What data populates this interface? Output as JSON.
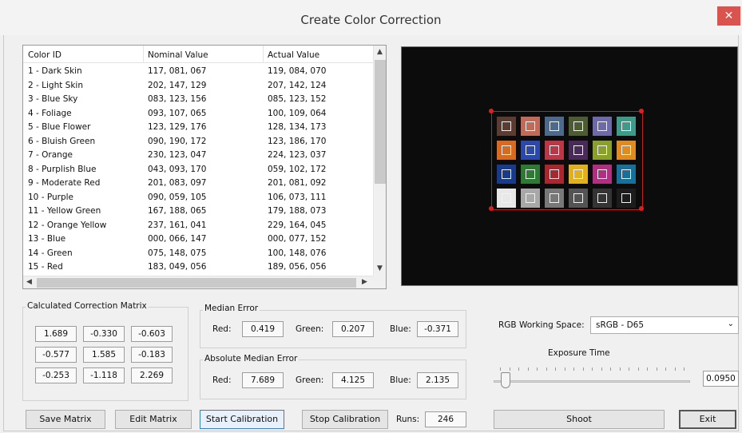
{
  "window": {
    "title": "Create Color Correction",
    "close_glyph": "✕"
  },
  "table": {
    "headers": [
      "Color ID",
      "Nominal Value",
      "Actual Value"
    ],
    "rows": [
      [
        "1 - Dark Skin",
        "117, 081, 067",
        "119, 084, 070"
      ],
      [
        "2 - Light Skin",
        "202, 147, 129",
        "207, 142, 124"
      ],
      [
        "3 - Blue Sky",
        "083, 123, 156",
        "085, 123, 152"
      ],
      [
        "4 - Foliage",
        "093, 107, 065",
        "100, 109, 064"
      ],
      [
        "5 - Blue Flower",
        "123, 129, 176",
        "128, 134, 173"
      ],
      [
        "6 - Bluish Green",
        "090, 190, 172",
        "123, 186, 170"
      ],
      [
        "7 - Orange",
        "230, 123, 047",
        "224, 123, 037"
      ],
      [
        "8 - Purplish Blue",
        "043, 093, 170",
        "059, 102, 172"
      ],
      [
        "9 - Moderate Red",
        "201, 083, 097",
        "201, 081, 092"
      ],
      [
        "10 - Purple",
        "090, 059, 105",
        "106, 073, 111"
      ],
      [
        "11 - Yellow Green",
        "167, 188, 065",
        "179, 188, 073"
      ],
      [
        "12 - Orange Yellow",
        "237, 161, 041",
        "229, 164, 045"
      ],
      [
        "13 - Blue",
        "000, 066, 147",
        "000, 077, 152"
      ],
      [
        "14 - Green",
        "075, 148, 075",
        "100, 148, 076"
      ],
      [
        "15 - Red",
        "183, 049, 056",
        "189, 056, 056"
      ]
    ]
  },
  "preview": {
    "patch_colors": [
      [
        "#5a3c32",
        "#c06a5a",
        "#4d6a8c",
        "#4e5c34",
        "#6e6aa8",
        "#3f9a88"
      ],
      [
        "#d66a20",
        "#2c48a8",
        "#b83848",
        "#4a2a58",
        "#8aa02c",
        "#e08a22"
      ],
      [
        "#1a3a8a",
        "#2e7a34",
        "#a82830",
        "#e0b020",
        "#b03080",
        "#1a6e9a"
      ],
      [
        "#e8e8e8",
        "#a8a8a8",
        "#787878",
        "#545454",
        "#343434",
        "#1c1c1c"
      ]
    ]
  },
  "matrix": {
    "label": "Calculated Correction Matrix",
    "values": [
      [
        "1.689",
        "-0.330",
        "-0.603"
      ],
      [
        "-0.577",
        "1.585",
        "-0.183"
      ],
      [
        "-0.253",
        "-1.118",
        "2.269"
      ]
    ]
  },
  "median_error": {
    "label": "Median Error",
    "red_label": "Red:",
    "red": "0.419",
    "green_label": "Green:",
    "green": "0.207",
    "blue_label": "Blue:",
    "blue": "-0.371"
  },
  "abs_median_error": {
    "label": "Absolute Median Error",
    "red_label": "Red:",
    "red": "7.689",
    "green_label": "Green:",
    "green": "4.125",
    "blue_label": "Blue:",
    "blue": "2.135"
  },
  "rgb_space": {
    "label": "RGB Working Space:",
    "value": "sRGB - D65"
  },
  "exposure": {
    "label": "Exposure Time",
    "value": "0.0950",
    "slider_fraction": 0.03
  },
  "buttons": {
    "save_matrix": "Save Matrix",
    "edit_matrix": "Edit Matrix",
    "start_calibration": "Start Calibration",
    "stop_calibration": "Stop Calibration",
    "shoot": "Shoot",
    "exit": "Exit"
  },
  "runs": {
    "label": "Runs:",
    "value": "246"
  }
}
